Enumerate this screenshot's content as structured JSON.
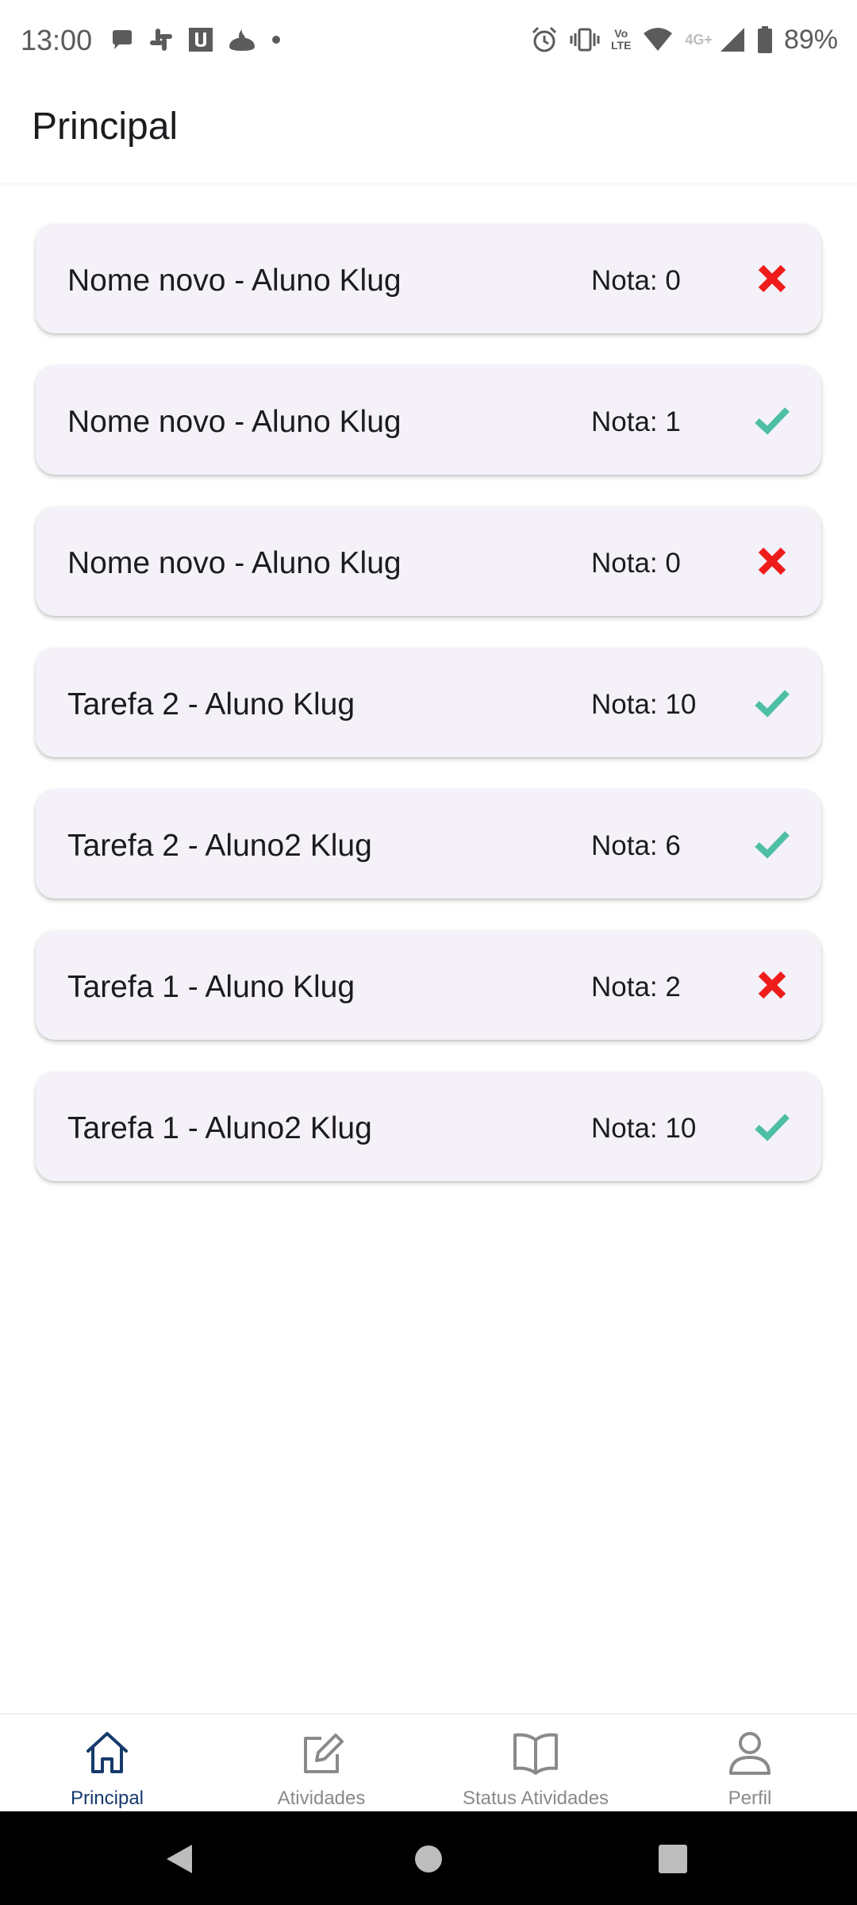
{
  "status_bar": {
    "time": "13:00",
    "battery": "89%",
    "network_label": "4G+",
    "volte_label_line1": "Vo",
    "volte_label_line2": "LTE"
  },
  "header": {
    "title": "Principal"
  },
  "tasks": [
    {
      "name": "Nome novo - Aluno Klug",
      "grade": "Nota: 0",
      "status": "incorrect"
    },
    {
      "name": "Nome novo - Aluno Klug",
      "grade": "Nota: 1",
      "status": "correct"
    },
    {
      "name": "Nome novo - Aluno Klug",
      "grade": "Nota: 0",
      "status": "incorrect"
    },
    {
      "name": "Tarefa 2 - Aluno Klug",
      "grade": "Nota: 10",
      "status": "correct"
    },
    {
      "name": "Tarefa 2 - Aluno2 Klug",
      "grade": "Nota: 6",
      "status": "correct"
    },
    {
      "name": "Tarefa 1 - Aluno Klug",
      "grade": "Nota: 2",
      "status": "incorrect"
    },
    {
      "name": "Tarefa 1 - Aluno2 Klug",
      "grade": "Nota: 10",
      "status": "correct"
    }
  ],
  "bottom_nav": {
    "items": [
      {
        "label": "Principal",
        "icon": "home-icon",
        "active": true
      },
      {
        "label": "Atividades",
        "icon": "edit-icon",
        "active": false
      },
      {
        "label": "Status Atividades",
        "icon": "book-icon",
        "active": false
      },
      {
        "label": "Perfil",
        "icon": "person-icon",
        "active": false
      }
    ]
  },
  "colors": {
    "card_background": "#f5f1f8",
    "correct": "#4dbfa5",
    "incorrect": "#ef1c1c",
    "nav_active": "#163a6b",
    "nav_inactive": "#8a8a8a"
  }
}
